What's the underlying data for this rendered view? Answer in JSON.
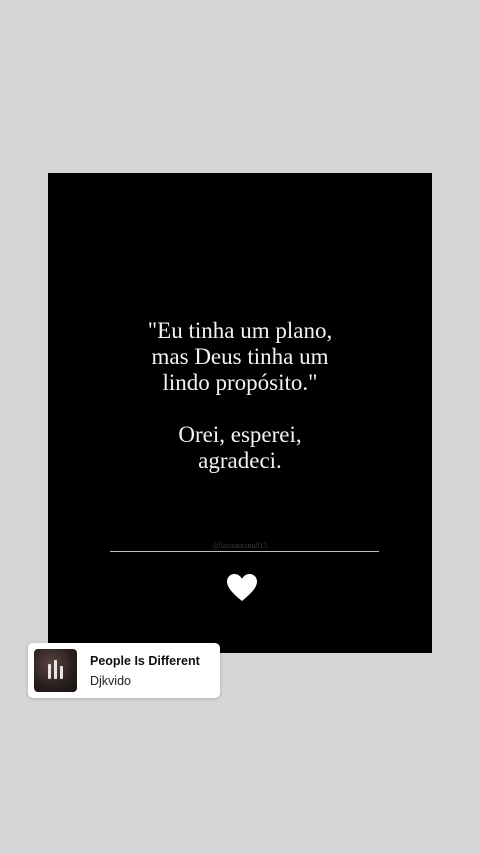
{
  "post": {
    "quote_lines": [
      "\"Eu tinha um plano,",
      "mas Deus tinha um",
      "lindo propósito.\""
    ],
    "closing_lines": [
      "Orei, esperei,",
      "agradeci."
    ],
    "watermark": "@laissantana815",
    "icon": "heart-icon"
  },
  "music_sticker": {
    "title": "People Is Different",
    "artist": "Djkvido",
    "icon": "music-bars-icon"
  },
  "colors": {
    "background": "#d5d5d5",
    "card": "#000000",
    "text": "#f2f2f2",
    "sticker": "#ffffff"
  }
}
